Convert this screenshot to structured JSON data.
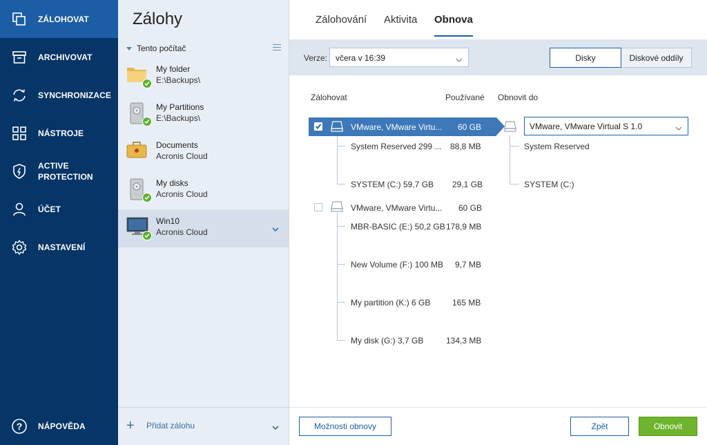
{
  "nav": {
    "items": [
      {
        "label": "ZÁLOHOVAT",
        "icon": "backup-icon"
      },
      {
        "label": "ARCHIVOVAT",
        "icon": "archive-icon"
      },
      {
        "label": "SYNCHRONIZACE",
        "icon": "sync-icon"
      },
      {
        "label": "NÁSTROJE",
        "icon": "tools-icon"
      },
      {
        "label": "ACTIVE PROTECTION",
        "icon": "shield-icon"
      },
      {
        "label": "ÚČET",
        "icon": "user-icon"
      },
      {
        "label": "NASTAVENÍ",
        "icon": "gear-icon"
      },
      {
        "label": "NÁPOVĚDA",
        "icon": "help-icon"
      }
    ]
  },
  "backups": {
    "title": "Zálohy",
    "section": "Tento počítač",
    "items": [
      {
        "name": "My folder",
        "location": "E:\\Backups\\",
        "icon": "folder-icon"
      },
      {
        "name": "My Partitions",
        "location": "E:\\Backups\\",
        "icon": "drive-icon"
      },
      {
        "name": "Documents",
        "location": "Acronis Cloud",
        "icon": "briefcase-icon"
      },
      {
        "name": "My disks",
        "location": "Acronis Cloud",
        "icon": "drive-icon"
      },
      {
        "name": "Win10",
        "location": "Acronis Cloud",
        "icon": "monitor-icon"
      }
    ],
    "add_label": "Přidat zálohu"
  },
  "tabs": [
    "Zálohování",
    "Aktivita",
    "Obnova"
  ],
  "toolbar": {
    "version_label": "Verze:",
    "version_value": "včera v 16:39",
    "seg_disks": "Disky",
    "seg_partitions": "Diskové oddíly"
  },
  "columns": {
    "backup": "Zálohovat",
    "used": "Používané",
    "restore_to": "Obnovit do"
  },
  "disks": [
    {
      "name": "VMware, VMware Virtu...",
      "size": "60 GB",
      "checked": true,
      "partitions": [
        {
          "name": "System Reserved 299 ...",
          "used": "88,8 MB"
        },
        {
          "name": "SYSTEM (C:) 59,7 GB",
          "used": "29,1 GB"
        }
      ]
    },
    {
      "name": "VMware, VMware Virtu...",
      "size": "60 GB",
      "checked": false,
      "partitions": [
        {
          "name": "MBR-BASIC (E:) 50,2 GB",
          "used": "178,9 MB"
        },
        {
          "name": "New Volume (F:) 100 MB",
          "used": "9,7 MB"
        },
        {
          "name": "My partition (K:) 6 GB",
          "used": "165 MB"
        },
        {
          "name": "My disk (G:) 3,7 GB",
          "used": "134,3 MB"
        }
      ]
    }
  ],
  "target": {
    "disk": "VMware, VMware Virtual S 1.0",
    "partitions": [
      "System Reserved",
      "SYSTEM (C:)"
    ]
  },
  "footer": {
    "options": "Možnosti obnovy",
    "back": "Zpět",
    "restore": "Obnovit"
  }
}
